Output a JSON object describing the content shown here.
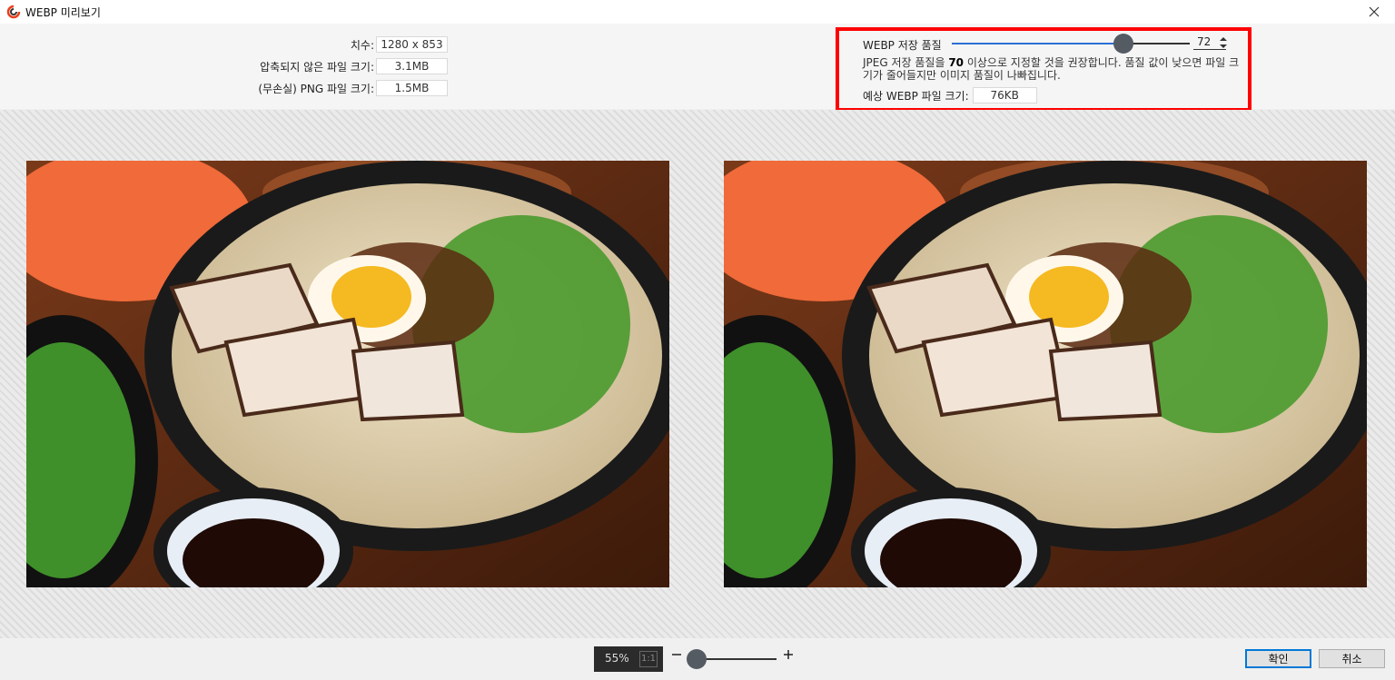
{
  "window": {
    "title": "WEBP 미리보기"
  },
  "info": {
    "dimensions_label": "치수:",
    "dimensions_value": "1280 x 853",
    "uncompressed_label": "압축되지 않은 파일 크기:",
    "uncompressed_value": "3.1MB",
    "png_label": "(무손실) PNG 파일 크기:",
    "png_value": "1.5MB"
  },
  "quality": {
    "label": "WEBP 저장 품질",
    "value": "72",
    "slider_fraction": 0.72,
    "hint_part1": "JPEG 저장 품질을 ",
    "hint_bold": "70",
    "hint_part2": " 이상으로 지정할 것을 권장합니다. 품질 값이 낮으면 파일 크기가 줄어들지만 이미지 품질이 나빠집니다.",
    "estimated_label": "예상 WEBP 파일 크기:",
    "estimated_value": "76KB"
  },
  "zoom": {
    "percent": "55%",
    "one_to_one": "1:1",
    "slider_fraction": 0.1
  },
  "buttons": {
    "ok": "확인",
    "cancel": "취소"
  },
  "colors": {
    "highlight": "#ff0000",
    "accent": "#0078d7",
    "slider": "#2a6fd4"
  }
}
